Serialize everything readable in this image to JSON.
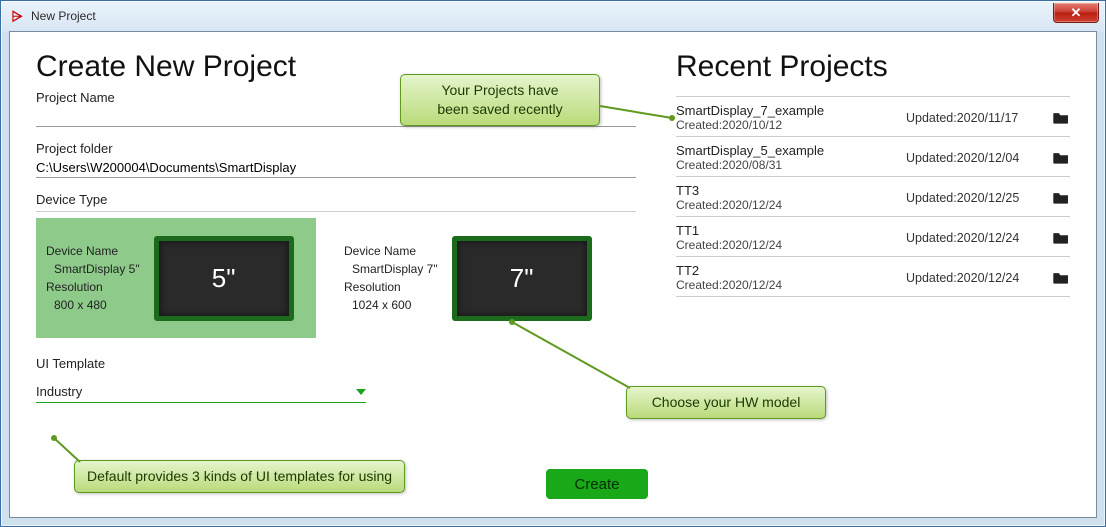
{
  "window": {
    "title": "New Project"
  },
  "left": {
    "heading": "Create New Project",
    "project_name_label": "Project Name",
    "project_name_value": "",
    "project_folder_label": "Project folder",
    "project_folder_value": "C:\\Users\\W200004\\Documents\\SmartDisplay",
    "device_type_label": "Device Type",
    "devices": [
      {
        "name_label": "Device Name",
        "name_value": "SmartDisplay 5\"",
        "res_label": "Resolution",
        "res_value": "800 x 480",
        "screen_text": "5\"",
        "selected": true
      },
      {
        "name_label": "Device Name",
        "name_value": "SmartDisplay 7\"",
        "res_label": "Resolution",
        "res_value": "1024 x 600",
        "screen_text": "7\"",
        "selected": false
      }
    ],
    "ui_template_label": "UI Template",
    "ui_template_value": "Industry",
    "create_button": "Create"
  },
  "right": {
    "heading": "Recent Projects",
    "created_prefix": "Created:",
    "updated_prefix": "Updated:",
    "items": [
      {
        "name": "SmartDisplay_7_example",
        "created": "2020/10/12",
        "updated": "2020/11/17"
      },
      {
        "name": "SmartDisplay_5_example",
        "created": "2020/08/31",
        "updated": "2020/12/04"
      },
      {
        "name": "TT3",
        "created": "2020/12/24",
        "updated": "2020/12/25"
      },
      {
        "name": "TT1",
        "created": "2020/12/24",
        "updated": "2020/12/24"
      },
      {
        "name": "TT2",
        "created": "2020/12/24",
        "updated": "2020/12/24"
      }
    ]
  },
  "callouts": {
    "recent_saved": "Your Projects have\nbeen saved recently",
    "hw_model": "Choose your HW model",
    "templates": "Default provides 3 kinds of UI templates for using"
  }
}
